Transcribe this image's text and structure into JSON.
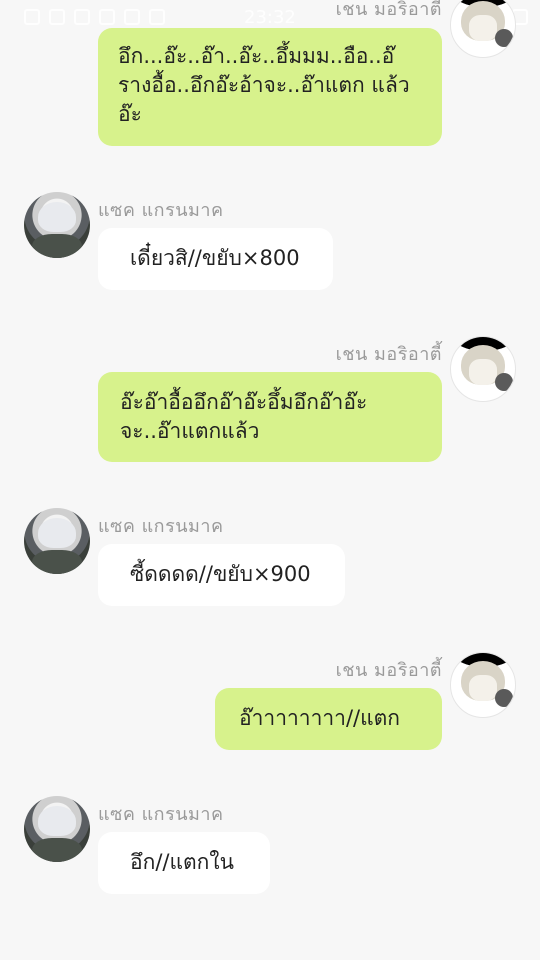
{
  "status_bar": {
    "time": "23:32"
  },
  "sender_name": "แซค แกรนมาค",
  "self_name": "เชน มอริอาตี้",
  "messages": [
    {
      "side": "self",
      "text": "อึก...อ๊ะ..อ๊า..อ๊ะ..อึ้มมม..อือ..อ๊ รางอื้อ..อึกอ๊ะอ้าจะ..อ๊าแตก แล้วอ๊ะ"
    },
    {
      "side": "sender",
      "text": "เดี๋ยวสิ//ขยับ×800"
    },
    {
      "side": "self",
      "text": "อ๊ะอ๊าอื้ออึกอ๊าอ๊ะอึ้มอึกอ๊าอ๊ะ จะ..อ๊าแตกแล้ว"
    },
    {
      "side": "sender",
      "text": "ซี้ดดดด//ขยับ×900"
    },
    {
      "side": "self",
      "text": "อ๊าาาาาาาา//แตก"
    },
    {
      "side": "sender",
      "text": "อึก//แตกใน"
    }
  ]
}
